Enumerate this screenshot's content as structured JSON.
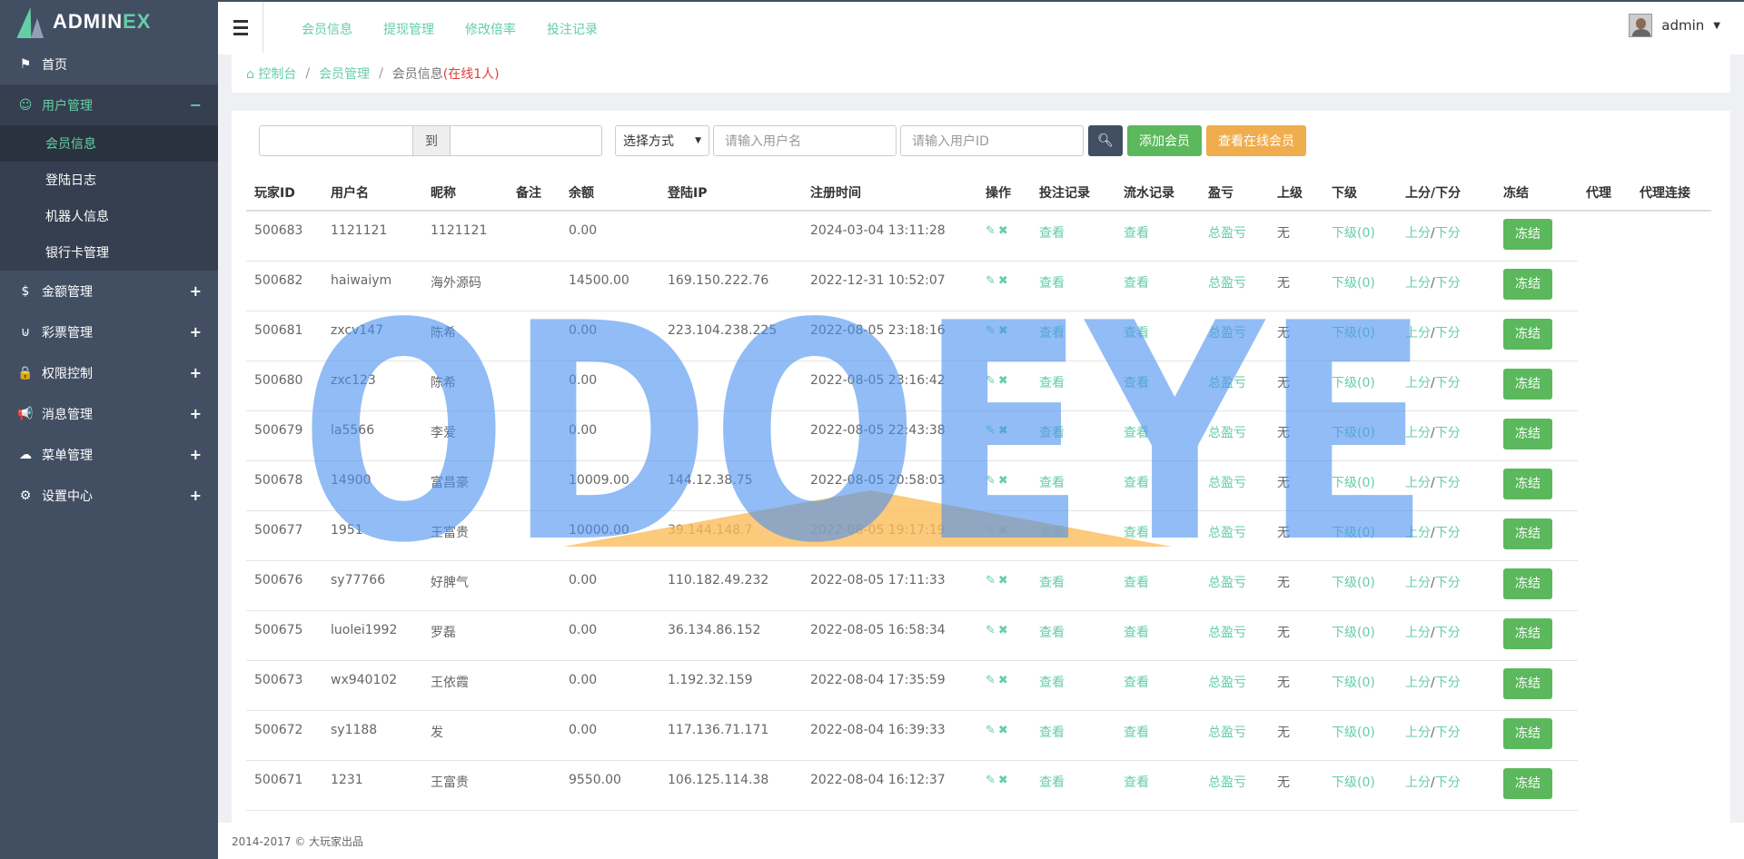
{
  "brand": {
    "name_a": "ADMIN",
    "name_b": "EX"
  },
  "sidebar": {
    "items": [
      {
        "icon": "flag-icon",
        "glyph": "⚑",
        "label": "首页",
        "toggle": ""
      },
      {
        "icon": "smile-icon",
        "glyph": "☺",
        "label": "用户管理",
        "toggle": "−"
      },
      {
        "icon": "dollar-icon",
        "glyph": "$",
        "label": "金额管理",
        "toggle": "+"
      },
      {
        "icon": "magnet-icon",
        "glyph": "⊍",
        "label": "彩票管理",
        "toggle": "+"
      },
      {
        "icon": "lock-icon",
        "glyph": "🔒",
        "label": "权限控制",
        "toggle": "+"
      },
      {
        "icon": "bullhorn-icon",
        "glyph": "📢",
        "label": "消息管理",
        "toggle": "+"
      },
      {
        "icon": "cloud-icon",
        "glyph": "☁",
        "label": "菜单管理",
        "toggle": "+"
      },
      {
        "icon": "cog-icon",
        "glyph": "⚙",
        "label": "设置中心",
        "toggle": "+"
      }
    ],
    "sub_items": [
      "会员信息",
      "登陆日志",
      "机器人信息",
      "银行卡管理"
    ]
  },
  "topnav": [
    "会员信息",
    "提现管理",
    "修改倍率",
    "投注记录"
  ],
  "user": {
    "name": "admin"
  },
  "breadcrumb": {
    "home": "控制台",
    "parent": "会员管理",
    "current": "会员信息",
    "online": "(在线1人)"
  },
  "filters": {
    "range_to": "到",
    "method": "选择方式",
    "username_placeholder": "请输入用户名",
    "userid_placeholder": "请输入用户ID",
    "add_label": "添加会员",
    "online_label": "查看在线会员"
  },
  "table": {
    "headers": [
      "玩家ID",
      "用户名",
      "昵称",
      "备注",
      "余额",
      "登陆IP",
      "注册时间",
      "操作",
      "投注记录",
      "流水记录",
      "盈亏",
      "上级",
      "下级",
      "上分/下分",
      "冻结",
      "代理",
      "代理连接"
    ],
    "link_view": "查看",
    "link_profit": "总盈亏",
    "link_sub": "下级(0)",
    "link_up": "上分",
    "link_down": "下分",
    "slash": "/",
    "freeze_label": "冻结",
    "rows": [
      {
        "id": "500683",
        "username": "1121121",
        "nickname": "1121121",
        "note": "",
        "balance": "0.00",
        "ip": "",
        "reg_time": "2024-03-04 13:11:28",
        "superior": "无"
      },
      {
        "id": "500682",
        "username": "haiwaiym",
        "nickname": "海外源码",
        "note": "",
        "balance": "14500.00",
        "ip": "169.150.222.76",
        "reg_time": "2022-12-31 10:52:07",
        "superior": "无"
      },
      {
        "id": "500681",
        "username": "zxcv147",
        "nickname": "陈希",
        "note": "",
        "balance": "0.00",
        "ip": "223.104.238.225",
        "reg_time": "2022-08-05 23:18:16",
        "superior": "无"
      },
      {
        "id": "500680",
        "username": "zxc123",
        "nickname": "陈希",
        "note": "",
        "balance": "0.00",
        "ip": "",
        "reg_time": "2022-08-05 23:16:42",
        "superior": "无"
      },
      {
        "id": "500679",
        "username": "la5566",
        "nickname": "李爱",
        "note": "",
        "balance": "0.00",
        "ip": "",
        "reg_time": "2022-08-05 22:43:38",
        "superior": "无"
      },
      {
        "id": "500678",
        "username": "14900",
        "nickname": "富昌豪",
        "note": "",
        "balance": "10009.00",
        "ip": "144.12.38.75",
        "reg_time": "2022-08-05 20:58:03",
        "superior": "无"
      },
      {
        "id": "500677",
        "username": "1951",
        "nickname": "王富贵",
        "note": "",
        "balance": "10000.00",
        "ip": "39.144.148.7",
        "reg_time": "2022-08-05 19:17:19",
        "superior": "无"
      },
      {
        "id": "500676",
        "username": "sy77766",
        "nickname": "好脾气",
        "note": "",
        "balance": "0.00",
        "ip": "110.182.49.232",
        "reg_time": "2022-08-05 17:11:33",
        "superior": "无"
      },
      {
        "id": "500675",
        "username": "luolei1992",
        "nickname": "罗磊",
        "note": "",
        "balance": "0.00",
        "ip": "36.134.86.152",
        "reg_time": "2022-08-05 16:58:34",
        "superior": "无"
      },
      {
        "id": "500673",
        "username": "wx940102",
        "nickname": "王依霞",
        "note": "",
        "balance": "0.00",
        "ip": "1.192.32.159",
        "reg_time": "2022-08-04 17:35:59",
        "superior": "无"
      },
      {
        "id": "500672",
        "username": "sy1188",
        "nickname": "发",
        "note": "",
        "balance": "0.00",
        "ip": "117.136.71.171",
        "reg_time": "2022-08-04 16:39:33",
        "superior": "无"
      },
      {
        "id": "500671",
        "username": "1231",
        "nickname": "王富贵",
        "note": "",
        "balance": "9550.00",
        "ip": "106.125.114.38",
        "reg_time": "2022-08-04 16:12:37",
        "superior": "无"
      }
    ]
  },
  "footer": {
    "text": "2014-2017 © 大玩家出品"
  },
  "watermark": {
    "text": "ODOEYE"
  },
  "colors": {
    "accent": "#65cea7",
    "sidebar": "#424f63",
    "success": "#5cb85c",
    "warning": "#f0ad4e",
    "danger": "#e23b3b"
  }
}
